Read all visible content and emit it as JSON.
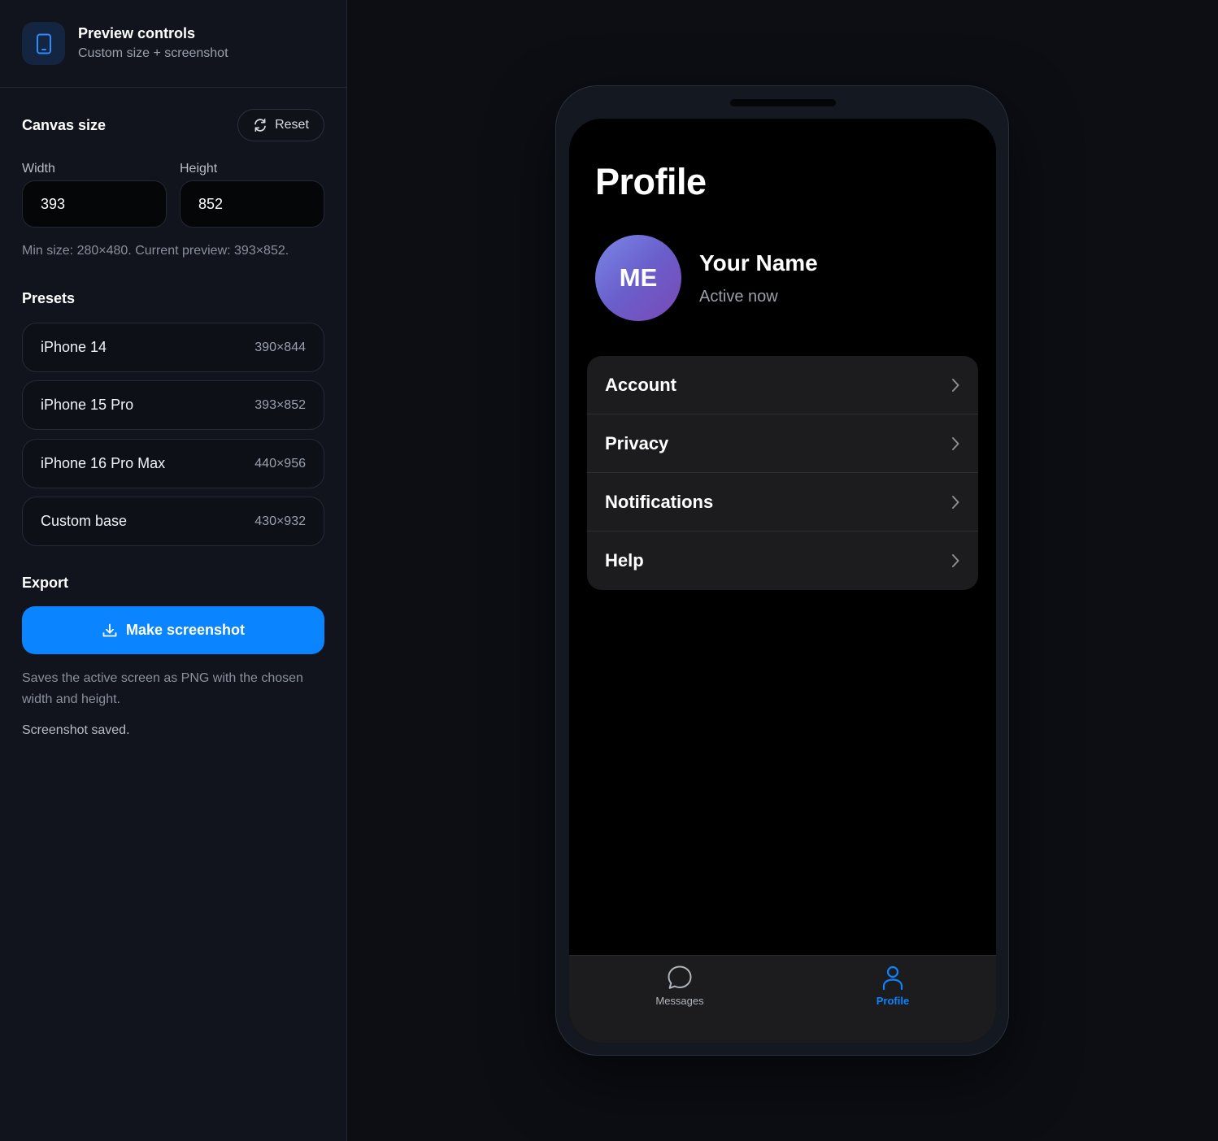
{
  "sidebar": {
    "title": "Preview controls",
    "subtitle": "Custom size + screenshot",
    "icon": "phone-icon",
    "canvas": {
      "title": "Canvas size",
      "reset_label": "Reset",
      "width_label": "Width",
      "width_value": "393",
      "height_label": "Height",
      "height_value": "852",
      "hint": "Min size: 280×480. Current preview: 393×852."
    },
    "presets": {
      "title": "Presets",
      "items": [
        {
          "name": "iPhone 14",
          "size": "390×844"
        },
        {
          "name": "iPhone 15 Pro",
          "size": "393×852"
        },
        {
          "name": "iPhone 16 Pro Max",
          "size": "440×956"
        },
        {
          "name": "Custom base",
          "size": "430×932"
        }
      ]
    },
    "export": {
      "title": "Export",
      "button_label": "Make screenshot",
      "note": "Saves the active screen as PNG with the chosen width and height.",
      "status": "Screenshot saved."
    }
  },
  "preview": {
    "page_title": "Profile",
    "avatar_initials": "ME",
    "user_name": "Your Name",
    "user_status": "Active now",
    "menu": [
      {
        "label": "Account"
      },
      {
        "label": "Privacy"
      },
      {
        "label": "Notifications"
      },
      {
        "label": "Help"
      }
    ],
    "tabs": [
      {
        "label": "Messages",
        "icon": "chat-bubble-icon",
        "active": false
      },
      {
        "label": "Profile",
        "icon": "person-icon",
        "active": true
      }
    ]
  },
  "colors": {
    "accent": "#0a84ff",
    "sidebar_bg": "#11141c",
    "page_bg": "#0c0e14",
    "screen_bg": "#000000",
    "card_bg": "#1c1c1e",
    "tab_inactive": "#b0b4bb"
  }
}
